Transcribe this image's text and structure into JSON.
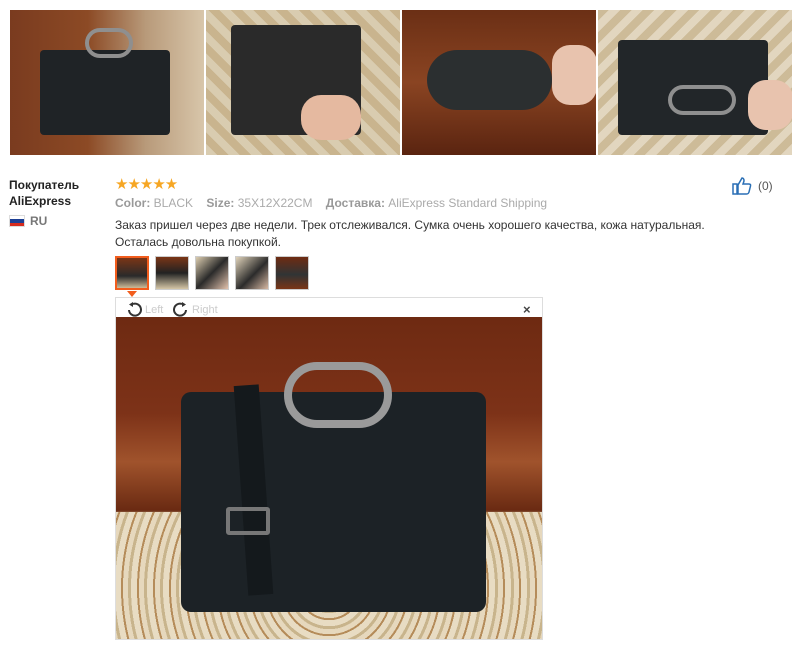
{
  "photos": [
    "bag-photo-1",
    "bag-photo-2",
    "bag-photo-3",
    "bag-photo-4"
  ],
  "author": {
    "name": "Покупатель AliExpress",
    "country": "RU"
  },
  "rating": {
    "stars": "★★★★★",
    "value": 5
  },
  "meta": {
    "color_label": "Color:",
    "color_value": "BLACK",
    "size_label": "Size:",
    "size_value": "35X12X22CM",
    "delivery_label": "Доставка:",
    "delivery_value": "AliExpress Standard Shipping"
  },
  "helpful": {
    "count": "(0)"
  },
  "review_text": "Заказ пришел через две недели. Трек отслеживался. Сумка очень хорошего качества, кожа натуральная. Осталась довольна покупкой.",
  "viewer": {
    "left_label": "Left",
    "right_label": "Right",
    "close_label": "×"
  },
  "colors": {
    "star": "#f6a623",
    "accent": "#f25d1d"
  }
}
